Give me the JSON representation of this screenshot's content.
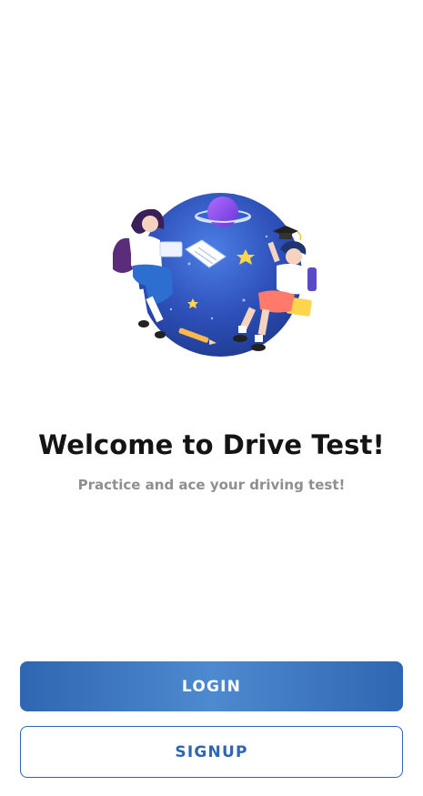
{
  "welcome": {
    "title": "Welcome to Drive Test!",
    "subtitle": "Practice and ace your driving test!"
  },
  "actions": {
    "login_label": "LOGIN",
    "signup_label": "SIGNUP"
  },
  "colors": {
    "primary": "#2f66b1",
    "primary_light": "#4e8ad0",
    "title_text": "#141414",
    "subtitle_text": "#8f8f8f",
    "background": "#ffffff"
  },
  "illustration": {
    "icons": [
      "planet-icon",
      "graduation-cap-icon",
      "open-book-icon",
      "star-icon",
      "pencil-icon"
    ]
  }
}
